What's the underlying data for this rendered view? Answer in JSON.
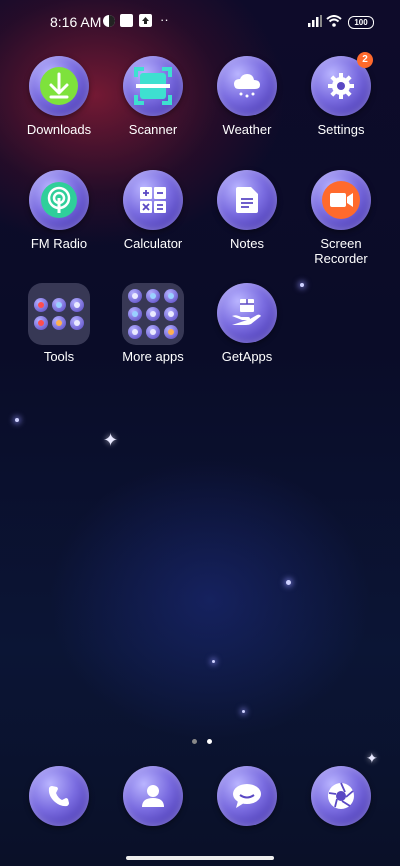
{
  "status_bar": {
    "time": "8:16 AM",
    "battery": "100"
  },
  "apps": [
    {
      "label": "Downloads",
      "icon": "download-icon"
    },
    {
      "label": "Scanner",
      "icon": "scanner-icon"
    },
    {
      "label": "Weather",
      "icon": "weather-icon"
    },
    {
      "label": "Settings",
      "icon": "gear-icon",
      "badge": "2"
    },
    {
      "label": "FM Radio",
      "icon": "radio-icon"
    },
    {
      "label": "Calculator",
      "icon": "calculator-icon"
    },
    {
      "label": "Notes",
      "icon": "notes-icon"
    },
    {
      "label": "Screen Recorder",
      "icon": "screen-recorder-icon"
    },
    {
      "label": "Tools",
      "icon": "folder-icon"
    },
    {
      "label": "More apps",
      "icon": "folder-icon"
    },
    {
      "label": "GetApps",
      "icon": "getapps-icon"
    }
  ],
  "dock": [
    {
      "icon": "phone-icon"
    },
    {
      "icon": "contacts-icon"
    },
    {
      "icon": "messages-icon"
    },
    {
      "icon": "camera-icon"
    }
  ],
  "page_indicator": {
    "pages": 2,
    "current": 2
  }
}
